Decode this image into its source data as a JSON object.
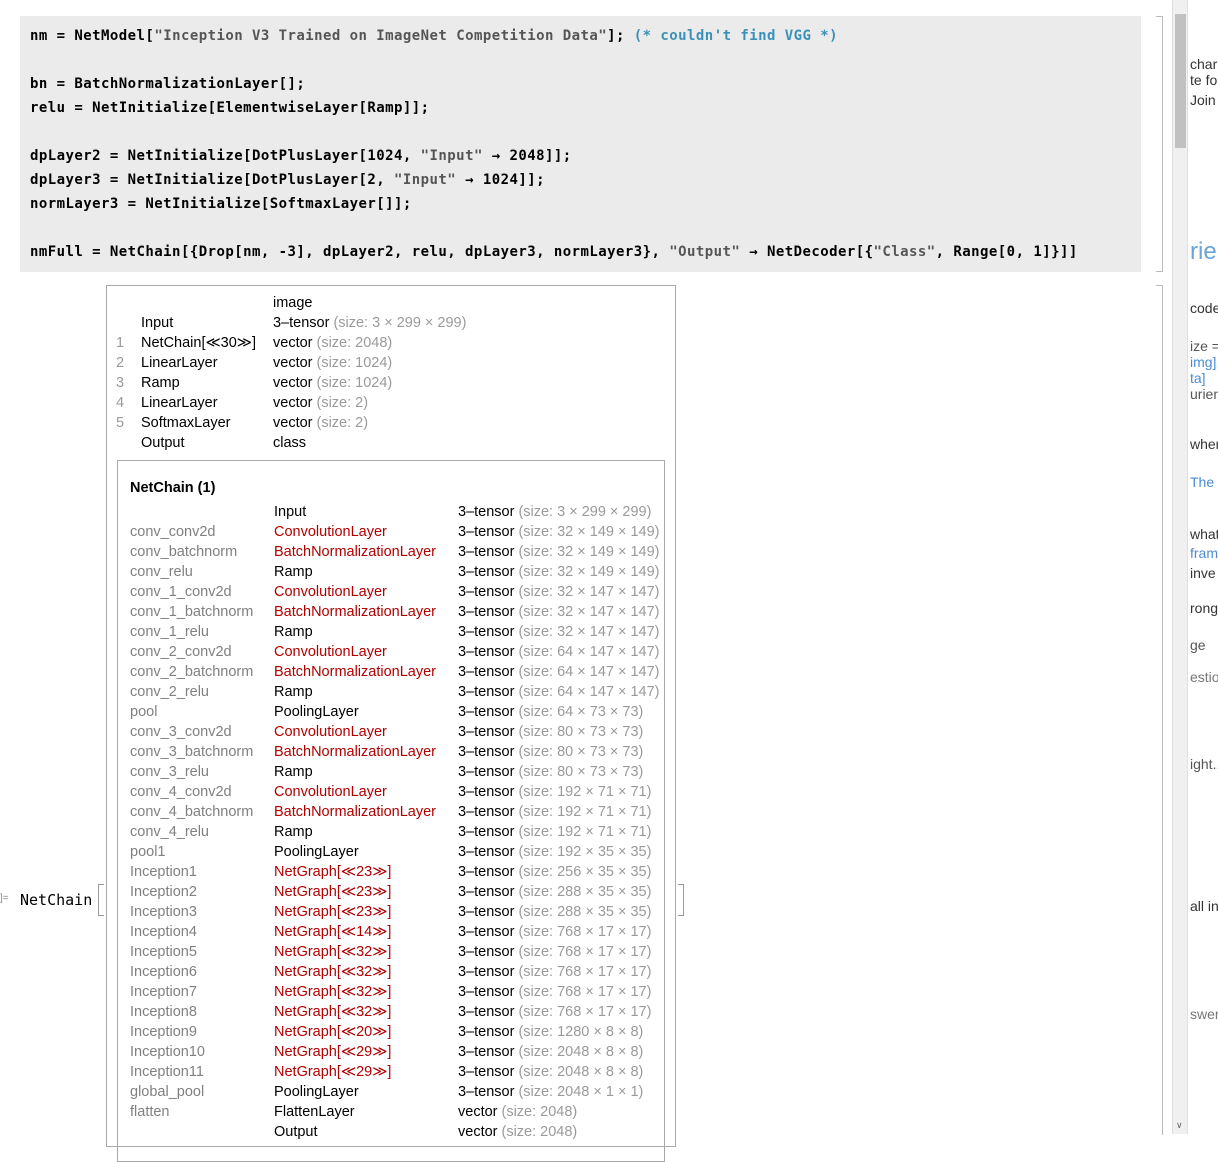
{
  "code": {
    "l1": {
      "a": "nm = NetModel[",
      "s": "\"Inception V3 Trained on ImageNet Competition Data\"",
      "b": "]; ",
      "c": "(* couldn't find VGG *)"
    },
    "l2": "bn = BatchNormalizationLayer[];",
    "l3": "relu = NetInitialize[ElementwiseLayer[Ramp]];",
    "l4": {
      "a": "dpLayer2 = NetInitialize[DotPlusLayer[1024, ",
      "s": "\"Input\"",
      "b": " → 2048]];"
    },
    "l5": {
      "a": "dpLayer3 = NetInitialize[DotPlusLayer[2, ",
      "s": "\"Input\"",
      "b": " → 1024]];"
    },
    "l6": "normLayer3 = NetInitialize[SoftmaxLayer[]];",
    "l7": {
      "a": "nmFull = NetChain[{Drop[nm, -3], dpLayer2, relu, dpLayer3, normLayer3}, ",
      "s": "\"Output\"",
      "b": " → NetDecoder[{",
      "s2": "\"Class\"",
      "c": ", Range[0, 1]}]]"
    }
  },
  "output": {
    "label": "]=",
    "head": "NetChain",
    "summary": [
      {
        "idx": "",
        "name": "",
        "type": "image",
        "size": ""
      },
      {
        "idx": "",
        "name": "Input",
        "type": "3‒tensor",
        "size": "(size: 3 × 299 × 299)"
      },
      {
        "idx": "1",
        "name": "NetChain[≪30≫]",
        "type": "vector",
        "size": "(size: 2048)"
      },
      {
        "idx": "2",
        "name": "LinearLayer",
        "type": "vector",
        "size": "(size: 1024)"
      },
      {
        "idx": "3",
        "name": "Ramp",
        "type": "vector",
        "size": "(size: 1024)"
      },
      {
        "idx": "4",
        "name": "LinearLayer",
        "type": "vector",
        "size": "(size: 2)"
      },
      {
        "idx": "5",
        "name": "SoftmaxLayer",
        "type": "vector",
        "size": "(size: 2)"
      },
      {
        "idx": "",
        "name": "Output",
        "type": "class",
        "size": ""
      }
    ],
    "inner_title": "NetChain (1)",
    "inner_rows": [
      {
        "name": "",
        "layer": "Input",
        "red": false,
        "type": "3‒tensor",
        "size": "(size: 3 × 299 × 299)"
      },
      {
        "name": "conv_conv2d",
        "layer": "ConvolutionLayer",
        "red": true,
        "type": "3‒tensor",
        "size": "(size: 32 × 149 × 149)"
      },
      {
        "name": "conv_batchnorm",
        "layer": "BatchNormalizationLayer",
        "red": true,
        "type": "3‒tensor",
        "size": "(size: 32 × 149 × 149)"
      },
      {
        "name": "conv_relu",
        "layer": "Ramp",
        "red": false,
        "type": "3‒tensor",
        "size": "(size: 32 × 149 × 149)"
      },
      {
        "name": "conv_1_conv2d",
        "layer": "ConvolutionLayer",
        "red": true,
        "type": "3‒tensor",
        "size": "(size: 32 × 147 × 147)"
      },
      {
        "name": "conv_1_batchnorm",
        "layer": "BatchNormalizationLayer",
        "red": true,
        "type": "3‒tensor",
        "size": "(size: 32 × 147 × 147)"
      },
      {
        "name": "conv_1_relu",
        "layer": "Ramp",
        "red": false,
        "type": "3‒tensor",
        "size": "(size: 32 × 147 × 147)"
      },
      {
        "name": "conv_2_conv2d",
        "layer": "ConvolutionLayer",
        "red": true,
        "type": "3‒tensor",
        "size": "(size: 64 × 147 × 147)"
      },
      {
        "name": "conv_2_batchnorm",
        "layer": "BatchNormalizationLayer",
        "red": true,
        "type": "3‒tensor",
        "size": "(size: 64 × 147 × 147)"
      },
      {
        "name": "conv_2_relu",
        "layer": "Ramp",
        "red": false,
        "type": "3‒tensor",
        "size": "(size: 64 × 147 × 147)"
      },
      {
        "name": "pool",
        "layer": "PoolingLayer",
        "red": false,
        "type": "3‒tensor",
        "size": "(size: 64 × 73 × 73)"
      },
      {
        "name": "conv_3_conv2d",
        "layer": "ConvolutionLayer",
        "red": true,
        "type": "3‒tensor",
        "size": "(size: 80 × 73 × 73)"
      },
      {
        "name": "conv_3_batchnorm",
        "layer": "BatchNormalizationLayer",
        "red": true,
        "type": "3‒tensor",
        "size": "(size: 80 × 73 × 73)"
      },
      {
        "name": "conv_3_relu",
        "layer": "Ramp",
        "red": false,
        "type": "3‒tensor",
        "size": "(size: 80 × 73 × 73)"
      },
      {
        "name": "conv_4_conv2d",
        "layer": "ConvolutionLayer",
        "red": true,
        "type": "3‒tensor",
        "size": "(size: 192 × 71 × 71)"
      },
      {
        "name": "conv_4_batchnorm",
        "layer": "BatchNormalizationLayer",
        "red": true,
        "type": "3‒tensor",
        "size": "(size: 192 × 71 × 71)"
      },
      {
        "name": "conv_4_relu",
        "layer": "Ramp",
        "red": false,
        "type": "3‒tensor",
        "size": "(size: 192 × 71 × 71)"
      },
      {
        "name": "pool1",
        "layer": "PoolingLayer",
        "red": false,
        "type": "3‒tensor",
        "size": "(size: 192 × 35 × 35)"
      },
      {
        "name": "Inception1",
        "layer": "NetGraph[≪23≫]",
        "red": true,
        "type": "3‒tensor",
        "size": "(size: 256 × 35 × 35)"
      },
      {
        "name": "Inception2",
        "layer": "NetGraph[≪23≫]",
        "red": true,
        "type": "3‒tensor",
        "size": "(size: 288 × 35 × 35)"
      },
      {
        "name": "Inception3",
        "layer": "NetGraph[≪23≫]",
        "red": true,
        "type": "3‒tensor",
        "size": "(size: 288 × 35 × 35)"
      },
      {
        "name": "Inception4",
        "layer": "NetGraph[≪14≫]",
        "red": true,
        "type": "3‒tensor",
        "size": "(size: 768 × 17 × 17)"
      },
      {
        "name": "Inception5",
        "layer": "NetGraph[≪32≫]",
        "red": true,
        "type": "3‒tensor",
        "size": "(size: 768 × 17 × 17)"
      },
      {
        "name": "Inception6",
        "layer": "NetGraph[≪32≫]",
        "red": true,
        "type": "3‒tensor",
        "size": "(size: 768 × 17 × 17)"
      },
      {
        "name": "Inception7",
        "layer": "NetGraph[≪32≫]",
        "red": true,
        "type": "3‒tensor",
        "size": "(size: 768 × 17 × 17)"
      },
      {
        "name": "Inception8",
        "layer": "NetGraph[≪32≫]",
        "red": true,
        "type": "3‒tensor",
        "size": "(size: 768 × 17 × 17)"
      },
      {
        "name": "Inception9",
        "layer": "NetGraph[≪20≫]",
        "red": true,
        "type": "3‒tensor",
        "size": "(size: 1280 × 8 × 8)"
      },
      {
        "name": "Inception10",
        "layer": "NetGraph[≪29≫]",
        "red": true,
        "type": "3‒tensor",
        "size": "(size: 2048 × 8 × 8)"
      },
      {
        "name": "Inception11",
        "layer": "NetGraph[≪29≫]",
        "red": true,
        "type": "3‒tensor",
        "size": "(size: 2048 × 8 × 8)"
      },
      {
        "name": "global_pool",
        "layer": "PoolingLayer",
        "red": false,
        "type": "3‒tensor",
        "size": "(size: 2048 × 1 × 1)"
      },
      {
        "name": "flatten",
        "layer": "FlattenLayer",
        "red": false,
        "type": "vector",
        "size": "(size: 2048)"
      },
      {
        "name": "",
        "layer": "Output",
        "red": false,
        "type": "vector",
        "size": "(size: 2048)"
      }
    ]
  },
  "right_page": [
    {
      "text": "char",
      "color": "#333"
    },
    {
      "text": "te fo",
      "color": "#333"
    },
    {
      "text": "Join",
      "color": "#333"
    },
    {
      "text": "rien",
      "color": "#6aa3d8"
    },
    {
      "text": "code",
      "color": "#333"
    },
    {
      "text": "ize =",
      "color": "#555"
    },
    {
      "text": "img],",
      "color": "#4a8bd0"
    },
    {
      "text": "ta]",
      "color": "#4a8bd0"
    },
    {
      "text": "urien",
      "color": "#555"
    },
    {
      "text": "wher",
      "color": "#333"
    },
    {
      "text": "The s",
      "color": "#4a8bd0"
    },
    {
      "text": "what",
      "color": "#333"
    },
    {
      "text": "fram",
      "color": "#4a8bd0"
    },
    {
      "text": "inve",
      "color": "#333"
    },
    {
      "text": "rong",
      "color": "#333"
    },
    {
      "text": "ge",
      "color": "#555"
    },
    {
      "text": "estio",
      "color": "#777"
    },
    {
      "text": "ight...",
      "color": "#555"
    },
    {
      "text": "all in",
      "color": "#333"
    },
    {
      "text": "swer",
      "color": "#777"
    }
  ]
}
